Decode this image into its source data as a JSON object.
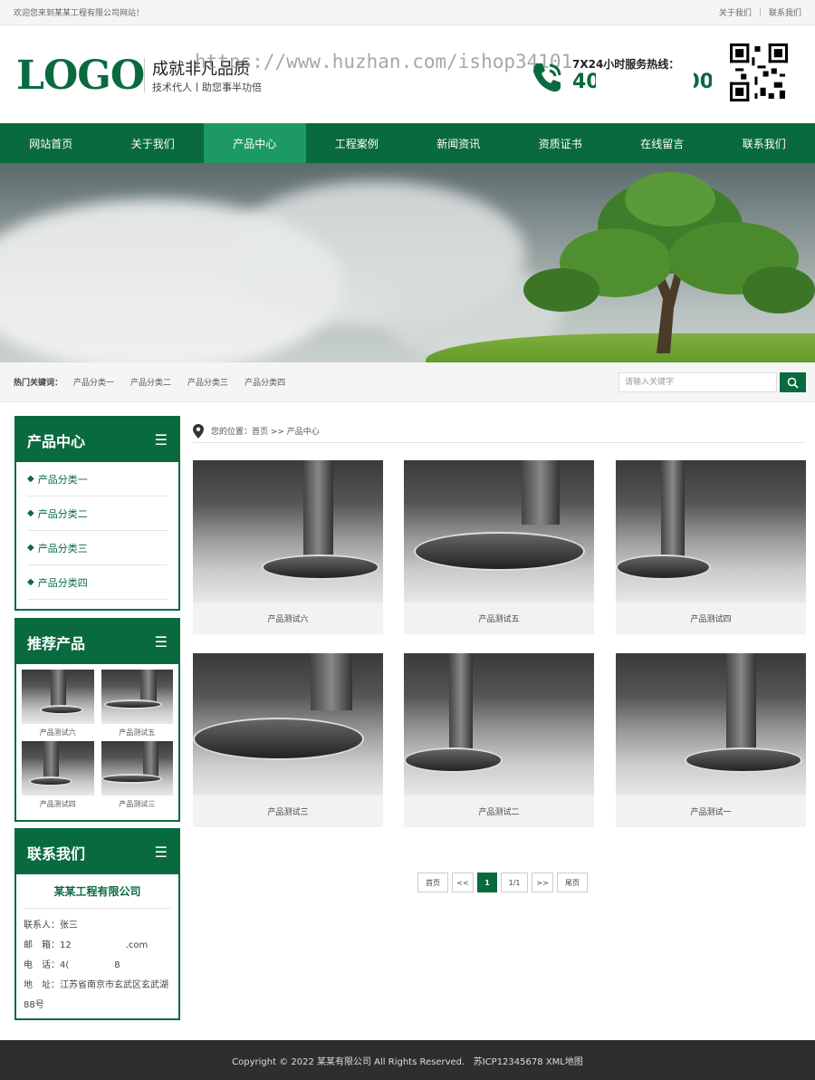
{
  "topbar": {
    "welcome": "欢迎您来到某某工程有限公司网站！",
    "links": [
      "关于我们",
      "联系我们"
    ],
    "separator": "|"
  },
  "header": {
    "logo": "LOGO",
    "slogan": "成就非凡品质",
    "sub_slogan": "技术代人丨助您事半功倍",
    "watermark": "https://www.huzhan.com/ishop34101",
    "hotline_label": "7X24小时服务热线：",
    "hotline_number": "400-000-0008",
    "phone_icon": "phone-icon",
    "qr_icon": "qr-code-icon"
  },
  "nav": {
    "items": [
      "网站首页",
      "关于我们",
      "产品中心",
      "工程案例",
      "新闻资讯",
      "资质证书",
      "在线留言",
      "联系我们"
    ],
    "active_index": 2
  },
  "search": {
    "hot_label": "热门关键词：",
    "keywords": [
      "产品分类一",
      "产品分类二",
      "产品分类三",
      "产品分类四"
    ],
    "placeholder": "请输入关键字",
    "button_icon": "search-icon"
  },
  "sidebar": {
    "products_title": "产品中心",
    "categories": [
      "产品分类一",
      "产品分类二",
      "产品分类三",
      "产品分类四"
    ],
    "recommended_title": "推荐产品",
    "recommended": [
      "产品测试六",
      "产品测试五",
      "产品测试四",
      "产品测试三"
    ],
    "contact_title": "联系我们",
    "company": "某某工程有限公司",
    "contact_lines": [
      "联系人：张三",
      "邮　箱：12　　　　　　.com",
      "电　话：4(　　　　　8",
      "地　址：江苏省南京市玄武区玄武湖88号"
    ],
    "menu_icon": "list-menu-icon"
  },
  "breadcrumb": {
    "text": "您的位置：首页 >> 产品中心",
    "icon": "location-pin-icon"
  },
  "products": [
    "产品测试六",
    "产品测试五",
    "产品测试四",
    "产品测试三",
    "产品测试二",
    "产品测试一"
  ],
  "pagination": {
    "first": "首页",
    "prev": "<<",
    "current": "1",
    "total": "1/1",
    "next": ">>",
    "last": "尾页"
  },
  "footer": {
    "text": "Copyright © 2022 某某有限公司 All Rights Reserved.   苏ICP12345678 XML地图"
  },
  "colors": {
    "brand_green": "#0a6a3f",
    "active_nav": "#1d9a63"
  }
}
